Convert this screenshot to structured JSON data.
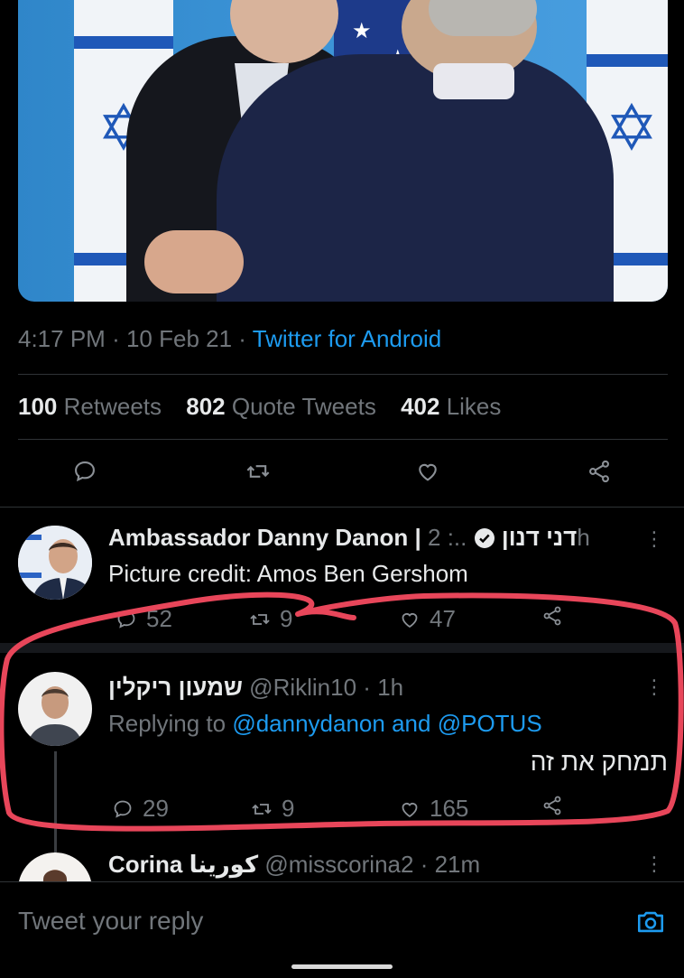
{
  "tweet": {
    "time": "4:17 PM",
    "date": "10 Feb 21",
    "source": "Twitter for Android",
    "retweets_count": "100",
    "retweets_label": "Retweets",
    "quotes_count": "802",
    "quotes_label": "Quote Tweets",
    "likes_count": "402",
    "likes_label": "Likes"
  },
  "replies": [
    {
      "name": "Ambassador Danny Danon | דני דנון",
      "time": "2h",
      "text": "Picture credit: Amos Ben Gershom",
      "replies": "52",
      "retweets": "9",
      "likes": "47"
    },
    {
      "name": "שמעון ריקלין",
      "handle": "@Riklin10",
      "time": "1h",
      "replying_label": "Replying to",
      "mention1": "@dannydanon",
      "and_label": "and",
      "mention2": "@POTUS",
      "text": "תמחק את זה",
      "replies": "29",
      "retweets": "9",
      "likes": "165"
    },
    {
      "name": "Corina كورينا",
      "handle": "@misscorina2",
      "time": "21m"
    }
  ],
  "compose": {
    "placeholder": "Tweet your reply"
  },
  "colors": {
    "background": "#000000",
    "link": "#1d9bf0",
    "muted": "#71767b",
    "annotation": "#e8465a"
  }
}
